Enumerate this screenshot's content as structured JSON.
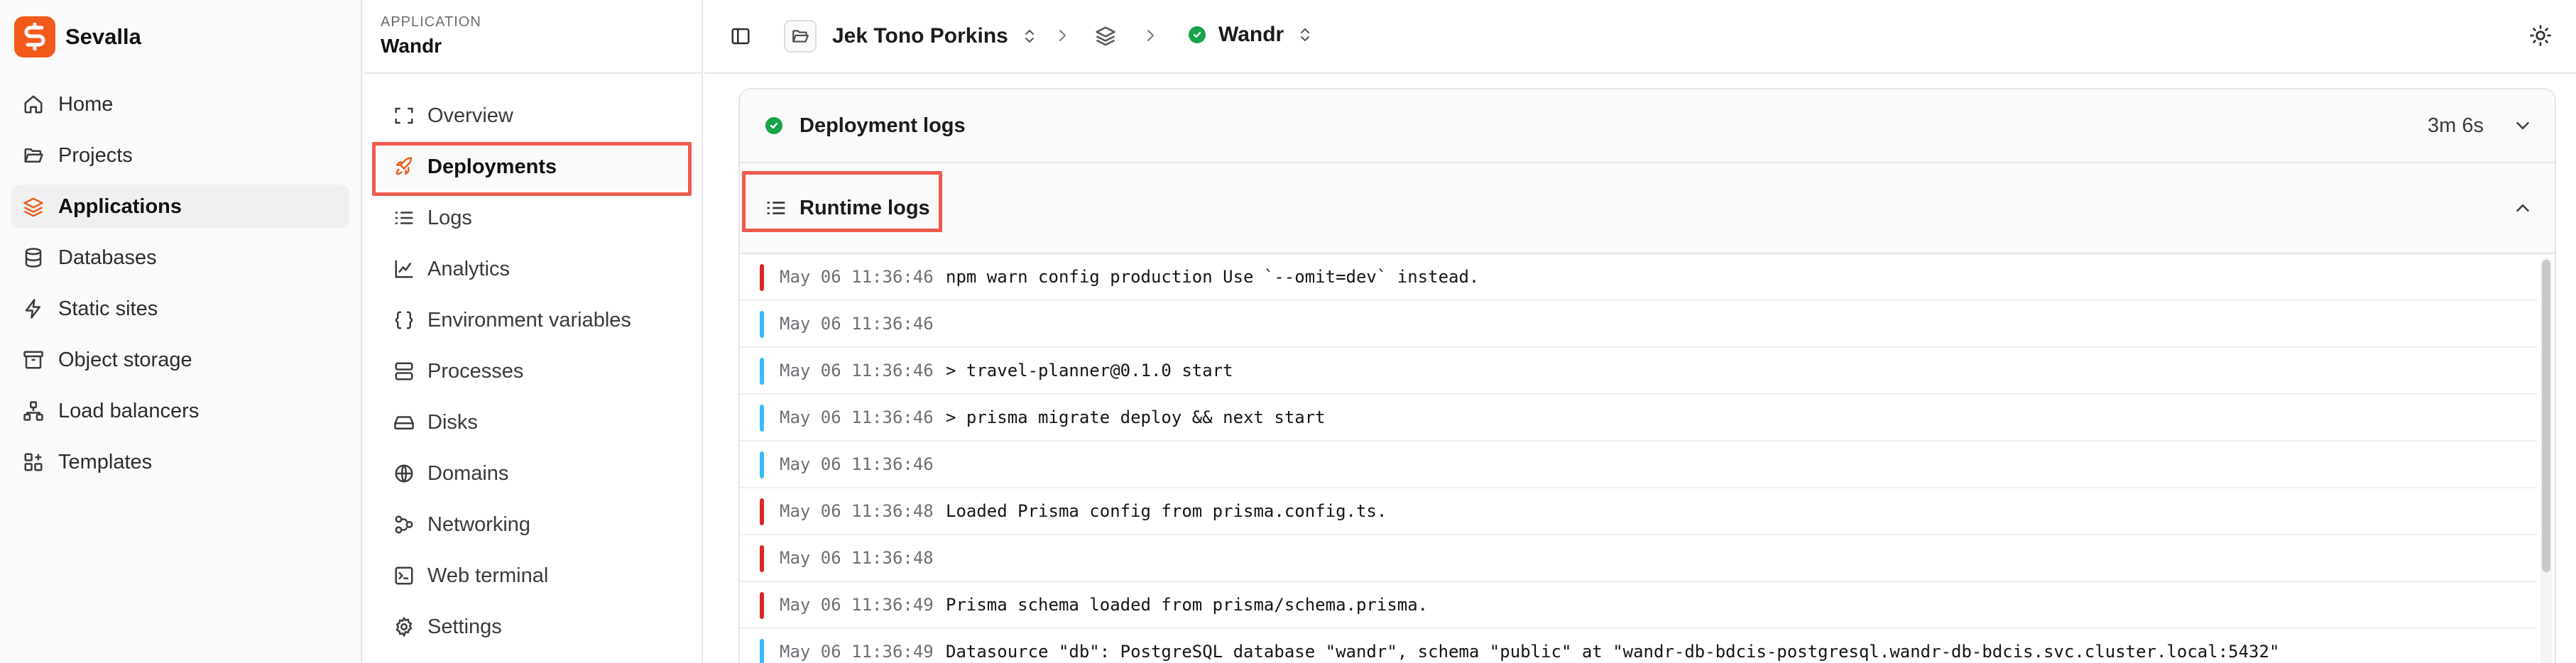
{
  "brand": {
    "name": "Sevalla",
    "color": "#f4591c"
  },
  "sidebar": {
    "items": [
      {
        "label": "Home",
        "icon": "home-icon"
      },
      {
        "label": "Projects",
        "icon": "folder-open-icon"
      },
      {
        "label": "Applications",
        "icon": "layers-icon",
        "active": true
      },
      {
        "label": "Databases",
        "icon": "database-icon"
      },
      {
        "label": "Static sites",
        "icon": "bolt-icon"
      },
      {
        "label": "Object storage",
        "icon": "archive-icon"
      },
      {
        "label": "Load balancers",
        "icon": "network-icon"
      },
      {
        "label": "Templates",
        "icon": "grid-plus-icon"
      }
    ]
  },
  "application": {
    "kicker": "APPLICATION",
    "name": "Wandr"
  },
  "subnav": {
    "items": [
      {
        "label": "Overview",
        "icon": "scan-icon"
      },
      {
        "label": "Deployments",
        "icon": "rocket-icon",
        "active": true
      },
      {
        "label": "Logs",
        "icon": "list-icon"
      },
      {
        "label": "Analytics",
        "icon": "line-chart-icon"
      },
      {
        "label": "Environment variables",
        "icon": "braces-icon"
      },
      {
        "label": "Processes",
        "icon": "server-icon"
      },
      {
        "label": "Disks",
        "icon": "hard-drive-icon"
      },
      {
        "label": "Domains",
        "icon": "globe-icon"
      },
      {
        "label": "Networking",
        "icon": "workflow-icon"
      },
      {
        "label": "Web terminal",
        "icon": "terminal-icon"
      },
      {
        "label": "Settings",
        "icon": "gear-icon"
      }
    ]
  },
  "topbar": {
    "project": "Jek Tono Porkins",
    "app": "Wandr",
    "status_color": "#16a34a"
  },
  "panels": {
    "deployment_logs": {
      "title": "Deployment logs",
      "duration": "3m 6s"
    },
    "runtime_logs": {
      "title": "Runtime logs"
    }
  },
  "logs": [
    {
      "time": "May 06 11:36:46",
      "message": "npm warn config production Use `--omit=dev` instead.",
      "level": "error"
    },
    {
      "time": "May 06 11:36:46",
      "message": "",
      "level": "info"
    },
    {
      "time": "May 06 11:36:46",
      "message": "> travel-planner@0.1.0 start",
      "level": "info"
    },
    {
      "time": "May 06 11:36:46",
      "message": "> prisma migrate deploy && next start",
      "level": "info"
    },
    {
      "time": "May 06 11:36:46",
      "message": "",
      "level": "info"
    },
    {
      "time": "May 06 11:36:48",
      "message": "Loaded Prisma config from prisma.config.ts.",
      "level": "error"
    },
    {
      "time": "May 06 11:36:48",
      "message": "",
      "level": "error"
    },
    {
      "time": "May 06 11:36:49",
      "message": "Prisma schema loaded from prisma/schema.prisma.",
      "level": "error"
    },
    {
      "time": "May 06 11:36:49",
      "message": "Datasource \"db\": PostgreSQL database \"wandr\", schema \"public\" at \"wandr-db-bdcis-postgresql.wandr-db-bdcis.svc.cluster.local:5432\"",
      "level": "info"
    }
  ],
  "colors": {
    "error": "#dc2626",
    "info": "#38bdf8",
    "highlight": "#ef5a4e",
    "accent": "#e9601f"
  }
}
